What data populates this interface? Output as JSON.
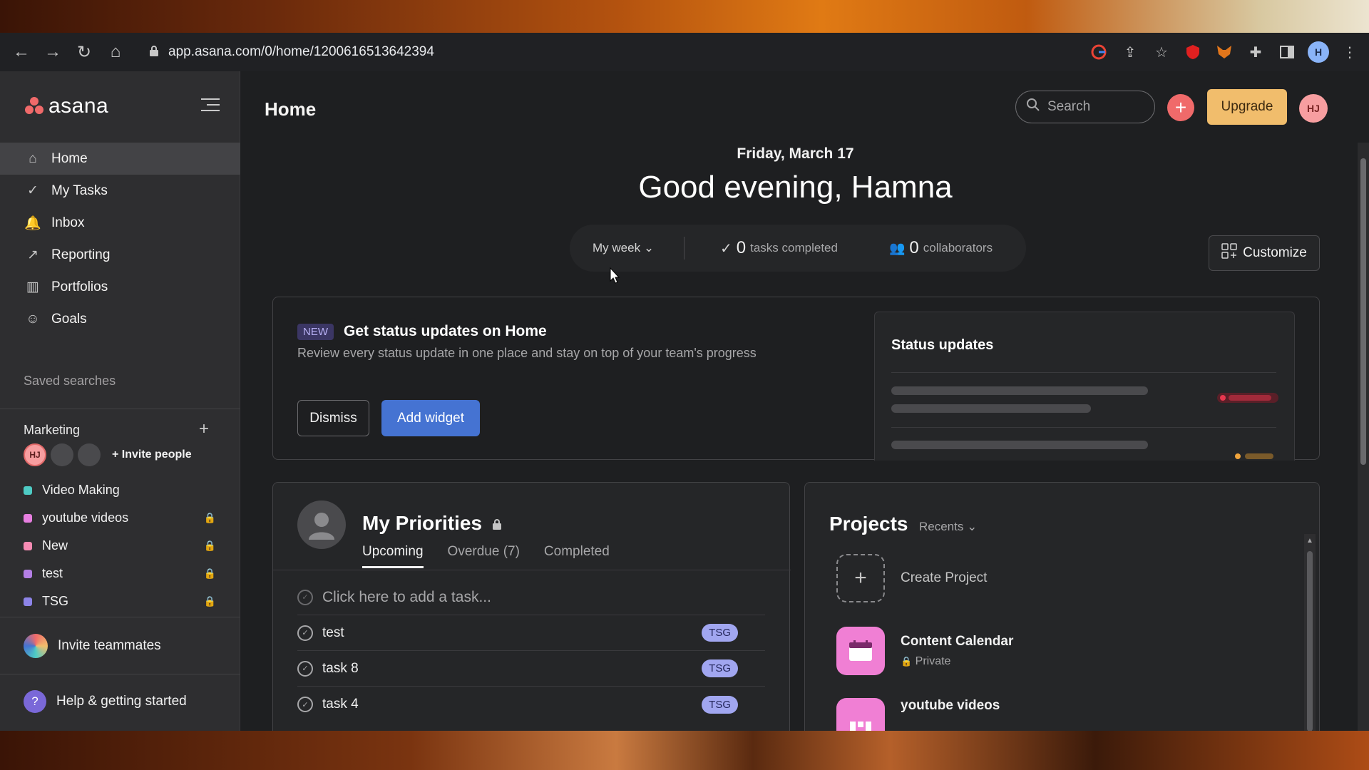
{
  "browser": {
    "url": "app.asana.com/0/home/1200616513642394",
    "back_icon": "←",
    "forward_icon": "→",
    "reload_icon": "↻",
    "home_icon": "⌂",
    "lock_icon": "🔒",
    "profile_initial": "H"
  },
  "sidebar": {
    "logo_text": "asana",
    "nav": [
      {
        "label": "Home",
        "icon": "⌂"
      },
      {
        "label": "My Tasks",
        "icon": "✓"
      },
      {
        "label": "Inbox",
        "icon": "🔔"
      },
      {
        "label": "Reporting",
        "icon": "↗"
      },
      {
        "label": "Portfolios",
        "icon": "▥"
      },
      {
        "label": "Goals",
        "icon": "☺"
      }
    ],
    "saved_searches": "Saved searches",
    "team": {
      "name": "Marketing",
      "add_icon": "+",
      "avatar_initials": "HJ",
      "invite_label": "+ Invite people"
    },
    "projects": [
      {
        "name": "Video Making",
        "color": "#4ecbc4",
        "private": false
      },
      {
        "name": "youtube videos",
        "color": "#e77fe0",
        "private": true
      },
      {
        "name": "New",
        "color": "#f68bb3",
        "private": true
      },
      {
        "name": "test",
        "color": "#b47fe6",
        "private": true
      },
      {
        "name": "TSG",
        "color": "#8d84e8",
        "private": true
      }
    ],
    "invite_teammates": "Invite teammates",
    "help": "Help & getting started",
    "help_icon": "?"
  },
  "header": {
    "title": "Home",
    "search_placeholder": "Search",
    "search_icon": "⌕",
    "plus_icon": "+",
    "upgrade_label": "Upgrade",
    "user_initials": "HJ"
  },
  "hero": {
    "date": "Friday, March 17",
    "greeting": "Good evening, Hamna",
    "week_label": "My week",
    "tasks_completed_count": "0",
    "tasks_completed_label": "tasks completed",
    "collaborators_count": "0",
    "collaborators_label": "collaborators",
    "customize_label": "Customize"
  },
  "status_widget": {
    "badge": "NEW",
    "title": "Get status updates on Home",
    "description": "Review every status update in one place and stay on top of your team's progress",
    "dismiss_label": "Dismiss",
    "add_label": "Add widget",
    "preview_title": "Status updates",
    "accent_red": "#e8384f",
    "accent_orange": "#f1a43c"
  },
  "priorities": {
    "title": "My Priorities",
    "lock_icon": "🔒",
    "tabs": [
      "Upcoming",
      "Overdue (7)",
      "Completed"
    ],
    "add_task_placeholder": "Click here to add a task...",
    "tasks": [
      {
        "name": "test",
        "tag": "TSG"
      },
      {
        "name": "task 8",
        "tag": "TSG"
      },
      {
        "name": "task 4",
        "tag": "TSG"
      }
    ]
  },
  "projects": {
    "title": "Projects",
    "filter": "Recents",
    "create_label": "Create Project",
    "items": [
      {
        "name": "Content Calendar",
        "sub": "Private",
        "color": "#f07fd4"
      },
      {
        "name": "youtube videos",
        "sub": "",
        "color": "#f07fd4"
      }
    ]
  }
}
